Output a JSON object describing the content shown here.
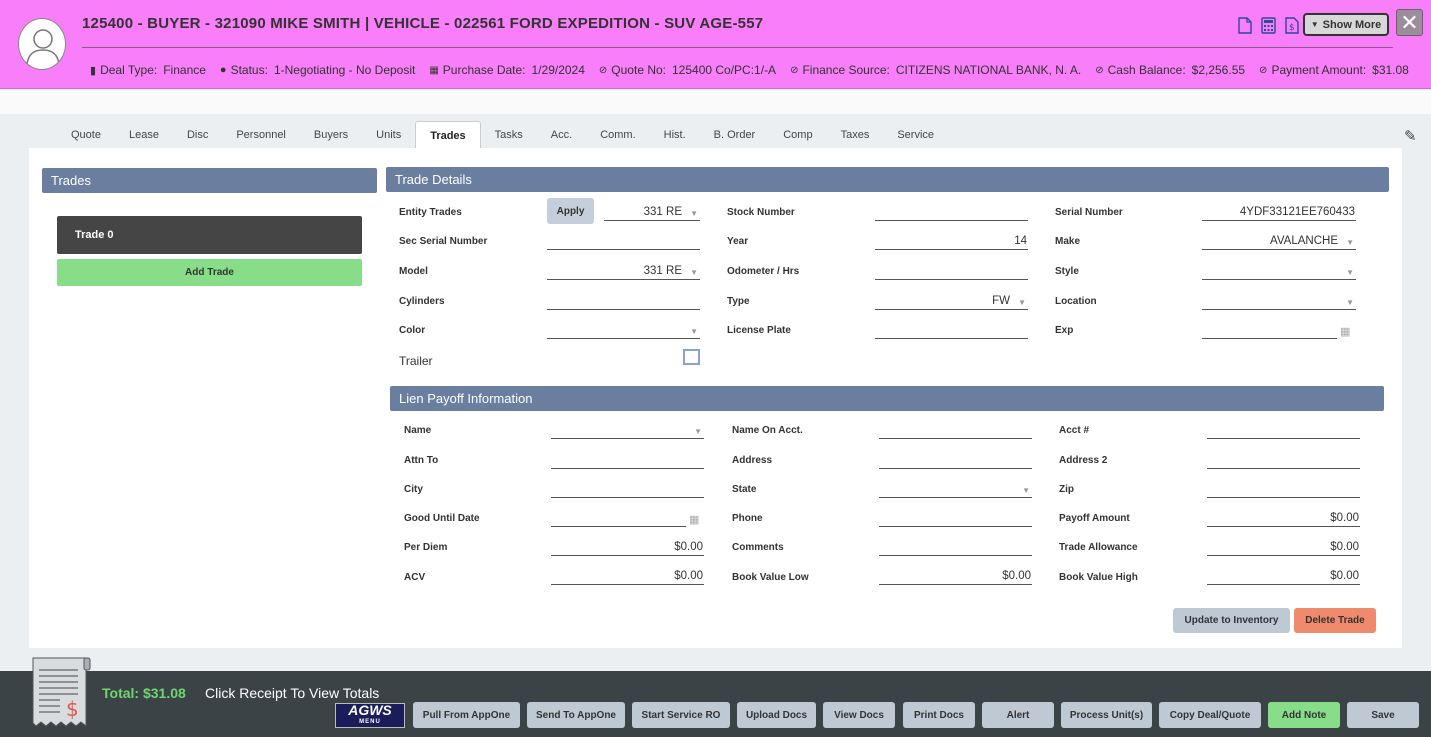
{
  "header": {
    "title": "125400 - BUYER - 321090 MIKE SMITH | VEHICLE - 022561 FORD EXPEDITION - SUV AGE-557",
    "info": [
      {
        "key": "Deal Type:",
        "value": "Finance",
        "icon": "document-copy-icon"
      },
      {
        "key": "Status:",
        "value": "1-Negotiating - No Deposit",
        "icon": "info-icon"
      },
      {
        "key": "Purchase Date:",
        "value": "1/29/2024",
        "icon": "calendar-icon"
      },
      {
        "key": "Quote No:",
        "value": "125400  Co/PC:1/-A",
        "icon": "check-circle-icon"
      },
      {
        "key": "Finance Source:",
        "value": "CITIZENS NATIONAL BANK, N. A.",
        "icon": "check-circle-icon"
      },
      {
        "key": "Cash Balance:",
        "value": "$2,256.55",
        "icon": "check-circle-icon"
      },
      {
        "key": "Payment Amount:",
        "value": "$31.08",
        "icon": "check-circle-icon"
      }
    ],
    "show_more": "Show More",
    "close": "✕"
  },
  "tabs": [
    "Quote",
    "Lease",
    "Disc",
    "Personnel",
    "Buyers",
    "Units",
    "Trades",
    "Tasks",
    "Acc.",
    "Comm.",
    "Hist.",
    "B. Order",
    "Comp",
    "Taxes",
    "Service"
  ],
  "active_tab": "Trades",
  "trades_panel": {
    "title": "Trades",
    "trade0": "Trade 0",
    "add_trade": "Add Trade"
  },
  "trade_details": {
    "title": "Trade Details",
    "apply": "Apply",
    "entity_trades_label": "Entity Trades",
    "entity_trades_value": "331 RE",
    "sec_serial_label": "Sec Serial Number",
    "sec_serial_value": "",
    "model_label": "Model",
    "model_value": "331 RE",
    "cylinders_label": "Cylinders",
    "cylinders_value": "",
    "color_label": "Color",
    "color_value": "",
    "trailer_label": "Trailer",
    "stock_label": "Stock Number",
    "stock_value": "",
    "year_label": "Year",
    "year_value": "14",
    "odometer_label": "Odometer / Hrs",
    "odometer_value": "",
    "type_label": "Type",
    "type_value": "FW",
    "license_label": "License Plate",
    "license_value": "",
    "serial_label": "Serial Number",
    "serial_value": "4YDF33121EE760433",
    "make_label": "Make",
    "make_value": "AVALANCHE",
    "style_label": "Style",
    "style_value": "",
    "location_label": "Location",
    "location_value": "",
    "exp_label": "Exp",
    "exp_value": ""
  },
  "lien": {
    "title": "Lien Payoff Information",
    "name_label": "Name",
    "name_value": "",
    "attn_label": "Attn To",
    "attn_value": "",
    "city_label": "City",
    "city_value": "",
    "good_until_label": "Good Until Date",
    "good_until_value": "",
    "per_diem_label": "Per Diem",
    "per_diem_value": "$0.00",
    "acv_label": "ACV",
    "acv_value": "$0.00",
    "name_on_acct_label": "Name On Acct.",
    "name_on_acct_value": "",
    "address_label": "Address",
    "address_value": "",
    "state_label": "State",
    "state_value": "",
    "phone_label": "Phone",
    "phone_value": "",
    "comments_label": "Comments",
    "comments_value": "",
    "bv_low_label": "Book Value Low",
    "bv_low_value": "$0.00",
    "acct_label": "Acct #",
    "acct_value": "",
    "address2_label": "Address 2",
    "address2_value": "",
    "zip_label": "Zip",
    "zip_value": "",
    "payoff_label": "Payoff Amount",
    "payoff_value": "$0.00",
    "trade_allow_label": "Trade Allowance",
    "trade_allow_value": "$0.00",
    "bv_high_label": "Book Value High",
    "bv_high_value": "$0.00"
  },
  "actions": {
    "update_inventory": "Update to Inventory",
    "delete_trade": "Delete Trade"
  },
  "footer": {
    "total": "Total: $31.08",
    "click_receipt": "Click Receipt To View Totals",
    "agws": "AGWS",
    "agws_menu": "MENU",
    "buttons": [
      "Pull From AppOne",
      "Send To AppOne",
      "Start Service RO",
      "Upload Docs",
      "View Docs",
      "Print Docs",
      "Alert",
      "Process Unit(s)",
      "Copy Deal/Quote",
      "Add Note",
      "Save"
    ]
  },
  "colors": {
    "header_bg": "#f97ef9",
    "section_head": "#6a7f9f",
    "add_green": "#87dd88",
    "delete_red": "#f08a6c",
    "footer_bg": "#3c4347"
  }
}
